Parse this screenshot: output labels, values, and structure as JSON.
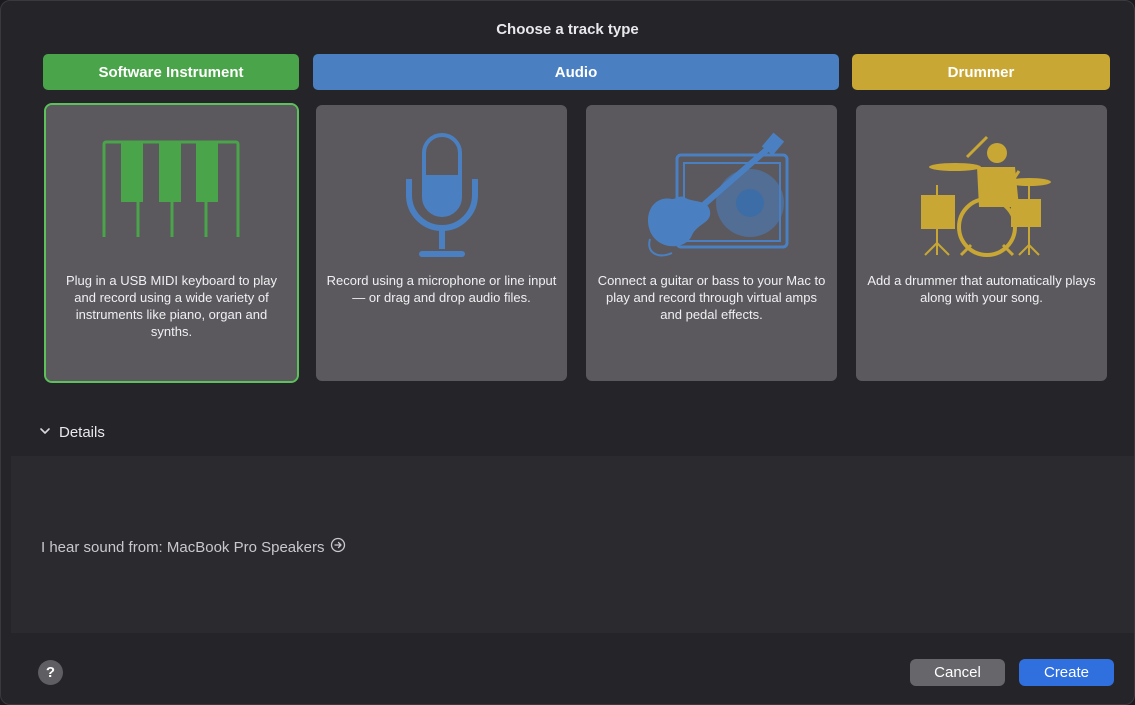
{
  "dialog": {
    "title": "Choose a track type"
  },
  "categories": {
    "software_instrument": "Software Instrument",
    "audio": "Audio",
    "drummer": "Drummer"
  },
  "cards": [
    {
      "icon": "piano-keyboard-icon",
      "description": "Plug in a USB MIDI keyboard to play and record using a wide variety of instruments like piano, organ and synths."
    },
    {
      "icon": "microphone-icon",
      "description": "Record using a microphone or line input — or drag and drop audio files."
    },
    {
      "icon": "guitar-amp-icon",
      "description": "Connect a guitar or bass to your Mac to play and record through virtual amps and pedal effects."
    },
    {
      "icon": "drummer-icon",
      "description": "Add a drummer that automatically plays along with your song."
    }
  ],
  "details": {
    "label": "Details",
    "output_text": "I hear sound from: MacBook Pro Speakers"
  },
  "footer": {
    "help": "?",
    "cancel": "Cancel",
    "create": "Create"
  },
  "colors": {
    "software_instrument": "#4aa44a",
    "audio": "#4a80c2",
    "drummer": "#c8a734",
    "create_button": "#2f6fde"
  }
}
